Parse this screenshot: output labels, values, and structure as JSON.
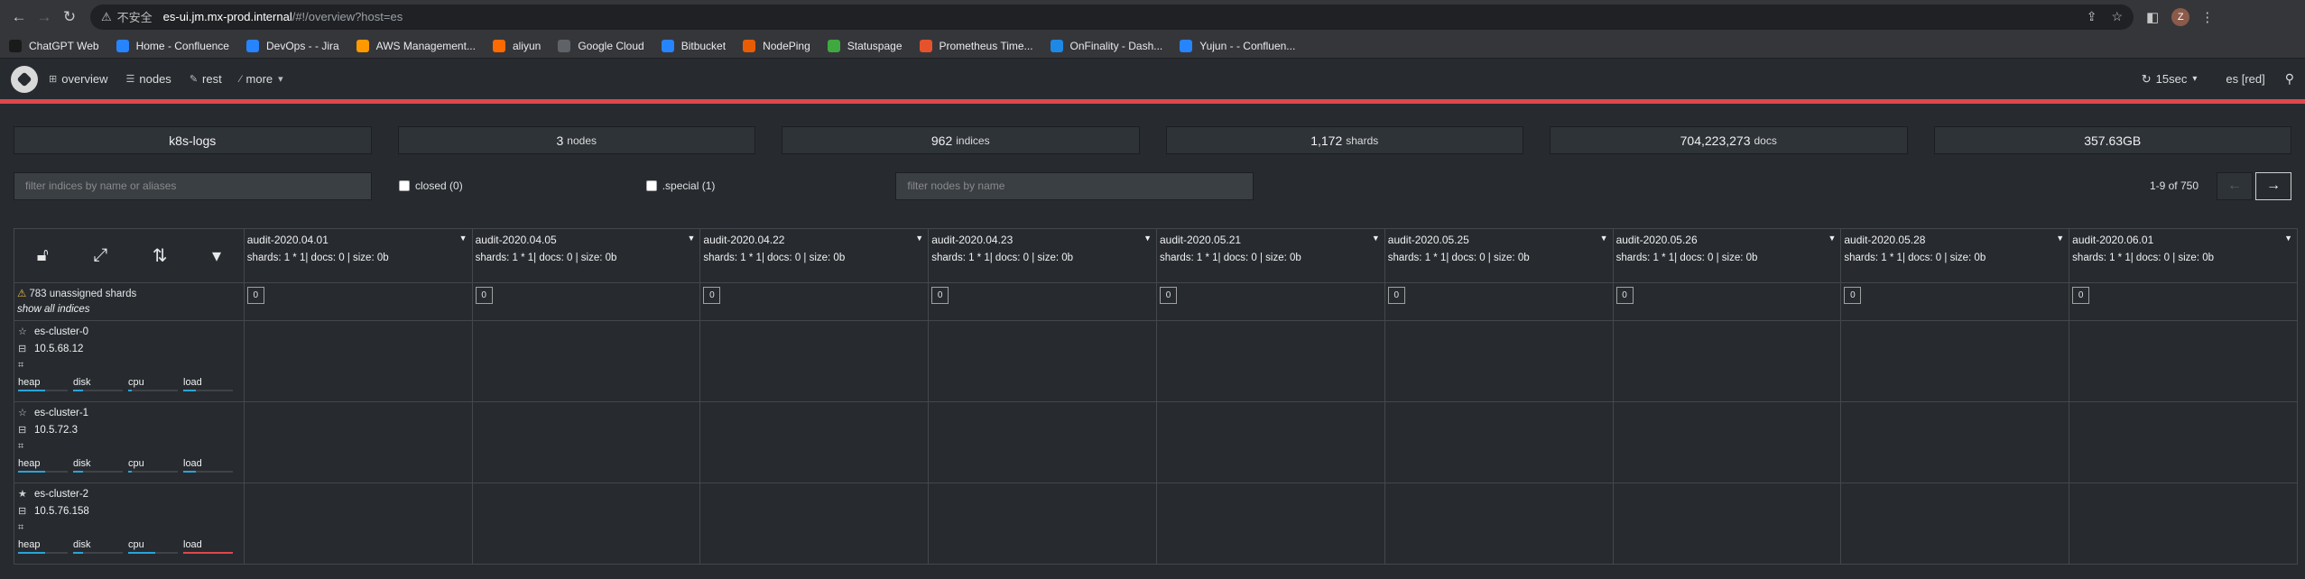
{
  "browser": {
    "insecure_label": "不安全",
    "url_host": "es-ui.jm.mx-prod.internal",
    "url_path": "/#!/overview?host=es",
    "avatar_letter": "Z",
    "bookmarks": [
      {
        "label": "ChatGPT Web",
        "color": "#1a1a1a"
      },
      {
        "label": "Home - Confluence",
        "color": "#2684ff"
      },
      {
        "label": "DevOps - - Jira",
        "color": "#2684ff"
      },
      {
        "label": "AWS Management...",
        "color": "#ff9900"
      },
      {
        "label": "aliyun",
        "color": "#ff6a00"
      },
      {
        "label": "Google Cloud",
        "color": "#5f6368"
      },
      {
        "label": "Bitbucket",
        "color": "#2684ff"
      },
      {
        "label": "NodePing",
        "color": "#e85d04"
      },
      {
        "label": "Statuspage",
        "color": "#3fa93f"
      },
      {
        "label": "Prometheus Time...",
        "color": "#e6522c"
      },
      {
        "label": "OnFinality - Dash...",
        "color": "#1e88e5"
      },
      {
        "label": "Yujun - - Confluen...",
        "color": "#2684ff"
      }
    ]
  },
  "nav": {
    "items": [
      {
        "label": "overview",
        "icon": "sitemap-icon"
      },
      {
        "label": "nodes",
        "icon": "list-icon"
      },
      {
        "label": "rest",
        "icon": "edit-icon"
      },
      {
        "label": "more",
        "icon": "wand-icon"
      }
    ],
    "refresh_label": "15sec",
    "cluster_label": "es [red]",
    "status_color": "#e0474c"
  },
  "stats": {
    "cluster_name": "k8s-logs",
    "nodes_value": "3",
    "nodes_unit": "nodes",
    "indices_value": "962",
    "indices_unit": "indices",
    "shards_value": "1,172",
    "shards_unit": "shards",
    "docs_value": "704,223,273",
    "docs_unit": "docs",
    "size_value": "357.63GB"
  },
  "filters": {
    "indices_placeholder": "filter indices by name or aliases",
    "closed_label": "closed (0)",
    "special_label": ".special (1)",
    "nodes_placeholder": "filter nodes by name",
    "page_count": "1-9 of 750",
    "prev_label": "←",
    "next_label": "→"
  },
  "grid": {
    "unassigned_text": "783 unassigned shards",
    "show_all_label": "show all indices",
    "indices": [
      {
        "name": "audit-2020.04.01",
        "meta": "shards: 1 * 1| docs: 0 | size: 0b",
        "shard": "0"
      },
      {
        "name": "audit-2020.04.05",
        "meta": "shards: 1 * 1| docs: 0 | size: 0b",
        "shard": "0"
      },
      {
        "name": "audit-2020.04.22",
        "meta": "shards: 1 * 1| docs: 0 | size: 0b",
        "shard": "0"
      },
      {
        "name": "audit-2020.04.23",
        "meta": "shards: 1 * 1| docs: 0 | size: 0b",
        "shard": "0"
      },
      {
        "name": "audit-2020.05.21",
        "meta": "shards: 1 * 1| docs: 0 | size: 0b",
        "shard": "0"
      },
      {
        "name": "audit-2020.05.25",
        "meta": "shards: 1 * 1| docs: 0 | size: 0b",
        "shard": "0"
      },
      {
        "name": "audit-2020.05.26",
        "meta": "shards: 1 * 1| docs: 0 | size: 0b",
        "shard": "0"
      },
      {
        "name": "audit-2020.05.28",
        "meta": "shards: 1 * 1| docs: 0 | size: 0b",
        "shard": "0"
      },
      {
        "name": "audit-2020.06.01",
        "meta": "shards: 1 * 1| docs: 0 | size: 0b",
        "shard": "0"
      }
    ],
    "nodes": [
      {
        "name": "es-cluster-0",
        "ip": "10.5.68.12",
        "master": false,
        "metrics": {
          "heap": 0.55,
          "disk": 0.2,
          "cpu": 0.08,
          "load": 0.25
        },
        "load_color": "#2aa3d8"
      },
      {
        "name": "es-cluster-1",
        "ip": "10.5.72.3",
        "master": false,
        "metrics": {
          "heap": 0.55,
          "disk": 0.2,
          "cpu": 0.08,
          "load": 0.25
        },
        "load_color": "#2aa3d8"
      },
      {
        "name": "es-cluster-2",
        "ip": "10.5.76.158",
        "master": true,
        "metrics": {
          "heap": 0.55,
          "disk": 0.2,
          "cpu": 0.55,
          "load": 1.0
        },
        "load_color": "#e0474c"
      }
    ],
    "metric_labels": {
      "heap": "heap",
      "disk": "disk",
      "cpu": "cpu",
      "load": "load"
    }
  }
}
